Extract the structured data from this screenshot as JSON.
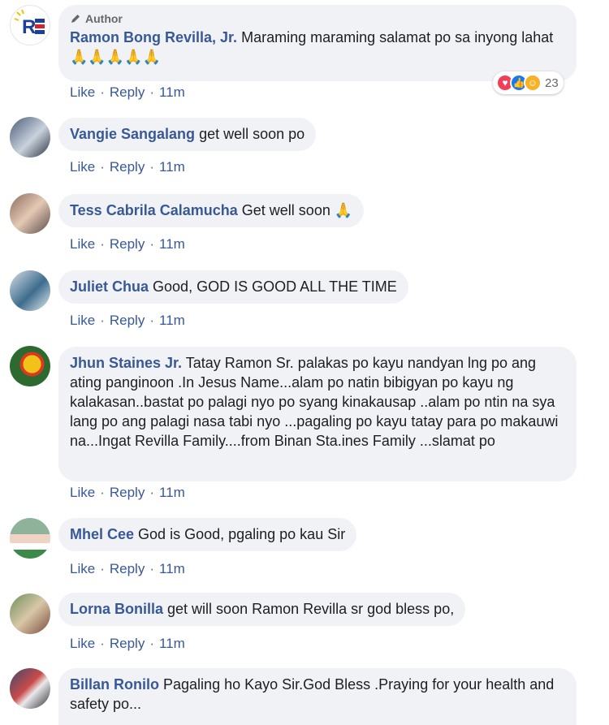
{
  "comments": [
    {
      "author_badge": "Author",
      "name": "Ramon Bong Revilla, Jr.",
      "text": "Maraming maraming salamat po sa inyong lahat🙏🙏🙏🙏🙏",
      "like": "Like",
      "reply": "Reply",
      "time": "11m",
      "reaction_count": "23"
    },
    {
      "name": "Vangie Sangalang",
      "text": "get well soon po",
      "like": "Like",
      "reply": "Reply",
      "time": "11m"
    },
    {
      "name": "Tess Cabrila Calamucha",
      "text": "Get well soon 🙏",
      "like": "Like",
      "reply": "Reply",
      "time": "11m"
    },
    {
      "name": "Juliet Chua",
      "text": "Good, GOD IS GOOD ALL THE TIME",
      "like": "Like",
      "reply": "Reply",
      "time": "11m"
    },
    {
      "name": "Jhun Staines Jr.",
      "text": "Tatay Ramon Sr. palakas po kayu nandyan lng po ang ating panginoon .In Jesus Name...alam po natin bibigyan po kayu ng kalakasan..bastat po palagi nyo po syang kinakausap ..alam po ntin na sya lang po ang palagi nasa tabi nyo ...pagaling po kayu tatay para po makauwi na...Ingat Revilla Family....from Binan Sta.ines Family ...slamat po",
      "like": "Like",
      "reply": "Reply",
      "time": "11m"
    },
    {
      "name": "Mhel Cee",
      "text": "God is Good, pgaling po kau Sir",
      "like": "Like",
      "reply": "Reply",
      "time": "11m"
    },
    {
      "name": "Lorna Bonilla",
      "text": "get will soon Ramon Revilla sr god bless po,",
      "like": "Like",
      "reply": "Reply",
      "time": "11m"
    },
    {
      "name": "Billan Ronilo",
      "text": "Pagaling ho Kayo Sir.God Bless .Praying for your health and safety po..."
    }
  ],
  "colors": {
    "name": "#385898",
    "bubble": "#f0f2f5",
    "meta": "#65676b",
    "love": "#f33e58",
    "like": "#1877f2",
    "care": "#f7b125"
  },
  "icons": {
    "author": "pencil-icon",
    "reactions": [
      "love-icon",
      "like-icon",
      "care-icon"
    ]
  }
}
